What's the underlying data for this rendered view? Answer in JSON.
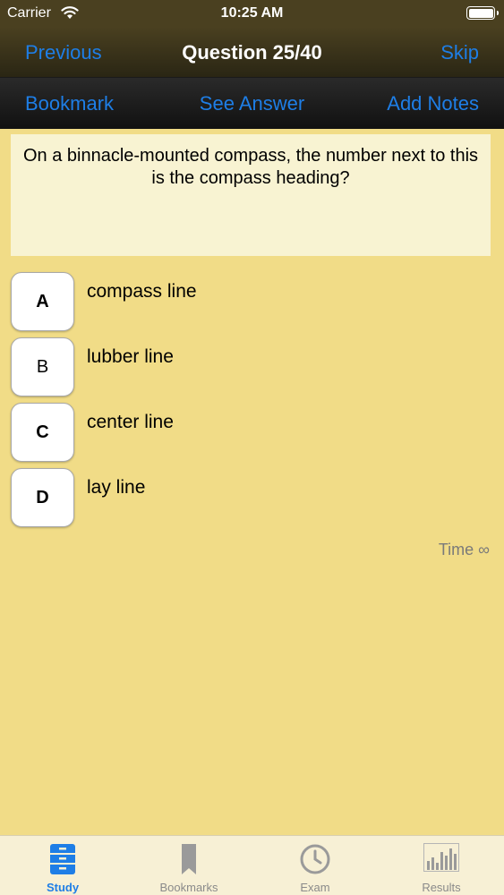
{
  "status_bar": {
    "carrier": "Carrier",
    "time": "10:25 AM"
  },
  "nav": {
    "previous": "Previous",
    "title": "Question 25/40",
    "skip": "Skip"
  },
  "toolbar": {
    "bookmark": "Bookmark",
    "see_answer": "See Answer",
    "add_notes": "Add Notes"
  },
  "question": {
    "text": "On a binnacle-mounted compass, the number next to this is the compass heading?"
  },
  "answers": [
    {
      "letter": "A",
      "text": "compass line"
    },
    {
      "letter": "B",
      "text": "lubber line"
    },
    {
      "letter": "C",
      "text": "center line"
    },
    {
      "letter": "D",
      "text": "lay line"
    }
  ],
  "timer": {
    "label": "Time ∞"
  },
  "tabs": [
    {
      "label": "Study",
      "icon": "drawers-icon",
      "active": true
    },
    {
      "label": "Bookmarks",
      "icon": "bookmark-icon",
      "active": false
    },
    {
      "label": "Exam",
      "icon": "clock-icon",
      "active": false
    },
    {
      "label": "Results",
      "icon": "bar-chart-icon",
      "active": false
    }
  ],
  "colors": {
    "accent": "#1e7ee6",
    "background": "#f1dc87",
    "question_box": "#f8f3d2"
  }
}
